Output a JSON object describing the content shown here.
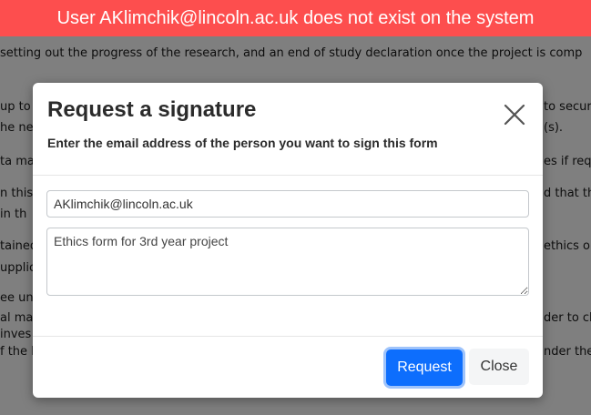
{
  "error_banner": {
    "text": "User AKlimchik@lincoln.ac.uk does not exist on the system",
    "color": "#fd4e4e"
  },
  "background_text": [
    "setting out the progress of the research, and an end of study declaration once the project is comp",
    "up to",
    "he ne",
    "ta ma",
    "n this",
    "in th",
    "tained",
    "upplica",
    "ee un",
    "al man",
    "inves",
    "f the F",
    "to secur",
    "(s).",
    "es if req",
    "d that th",
    "ethics o",
    "der to ch",
    "nder the"
  ],
  "modal": {
    "title": "Request a signature",
    "subtitle": "Enter the email address of the person you want to sign this form",
    "close_icon": "close-icon",
    "email_value": "AKlimchik@lincoln.ac.uk",
    "message_value": "Ethics form for 3rd year project",
    "request_label": "Request",
    "close_label": "Close",
    "primary_color": "#0d6efd"
  }
}
